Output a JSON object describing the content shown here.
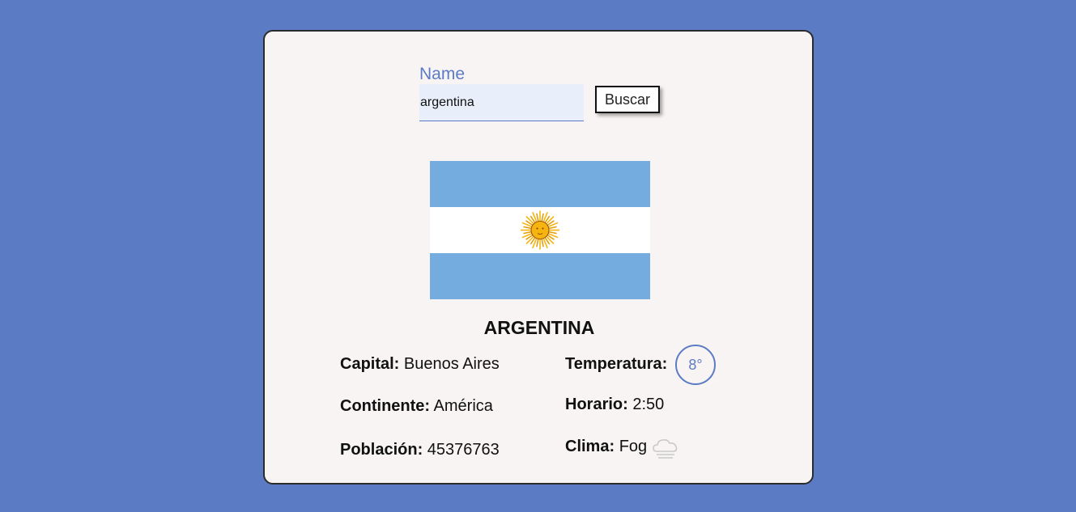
{
  "search": {
    "label": "Name",
    "value": "argentina",
    "button_label": "Buscar"
  },
  "country": {
    "name": "ARGENTINA",
    "capital_label": "Capital:",
    "capital": "Buenos Aires",
    "continent_label": "Continente:",
    "continent": "América",
    "population_label": "Población:",
    "population": "45376763",
    "temperature_label": "Temperatura:",
    "temperature": "8°",
    "time_label": "Horario:",
    "time": "2:50",
    "weather_label": "Clima:",
    "weather": "Fog",
    "weather_icon": "fog-cloud-icon"
  },
  "colors": {
    "background": "#5b7bc4",
    "card": "#f8f4f3",
    "accent": "#5b7bc4",
    "flag_blue": "#74acdf",
    "flag_white": "#ffffff",
    "flag_sun": "#f6b40e"
  }
}
